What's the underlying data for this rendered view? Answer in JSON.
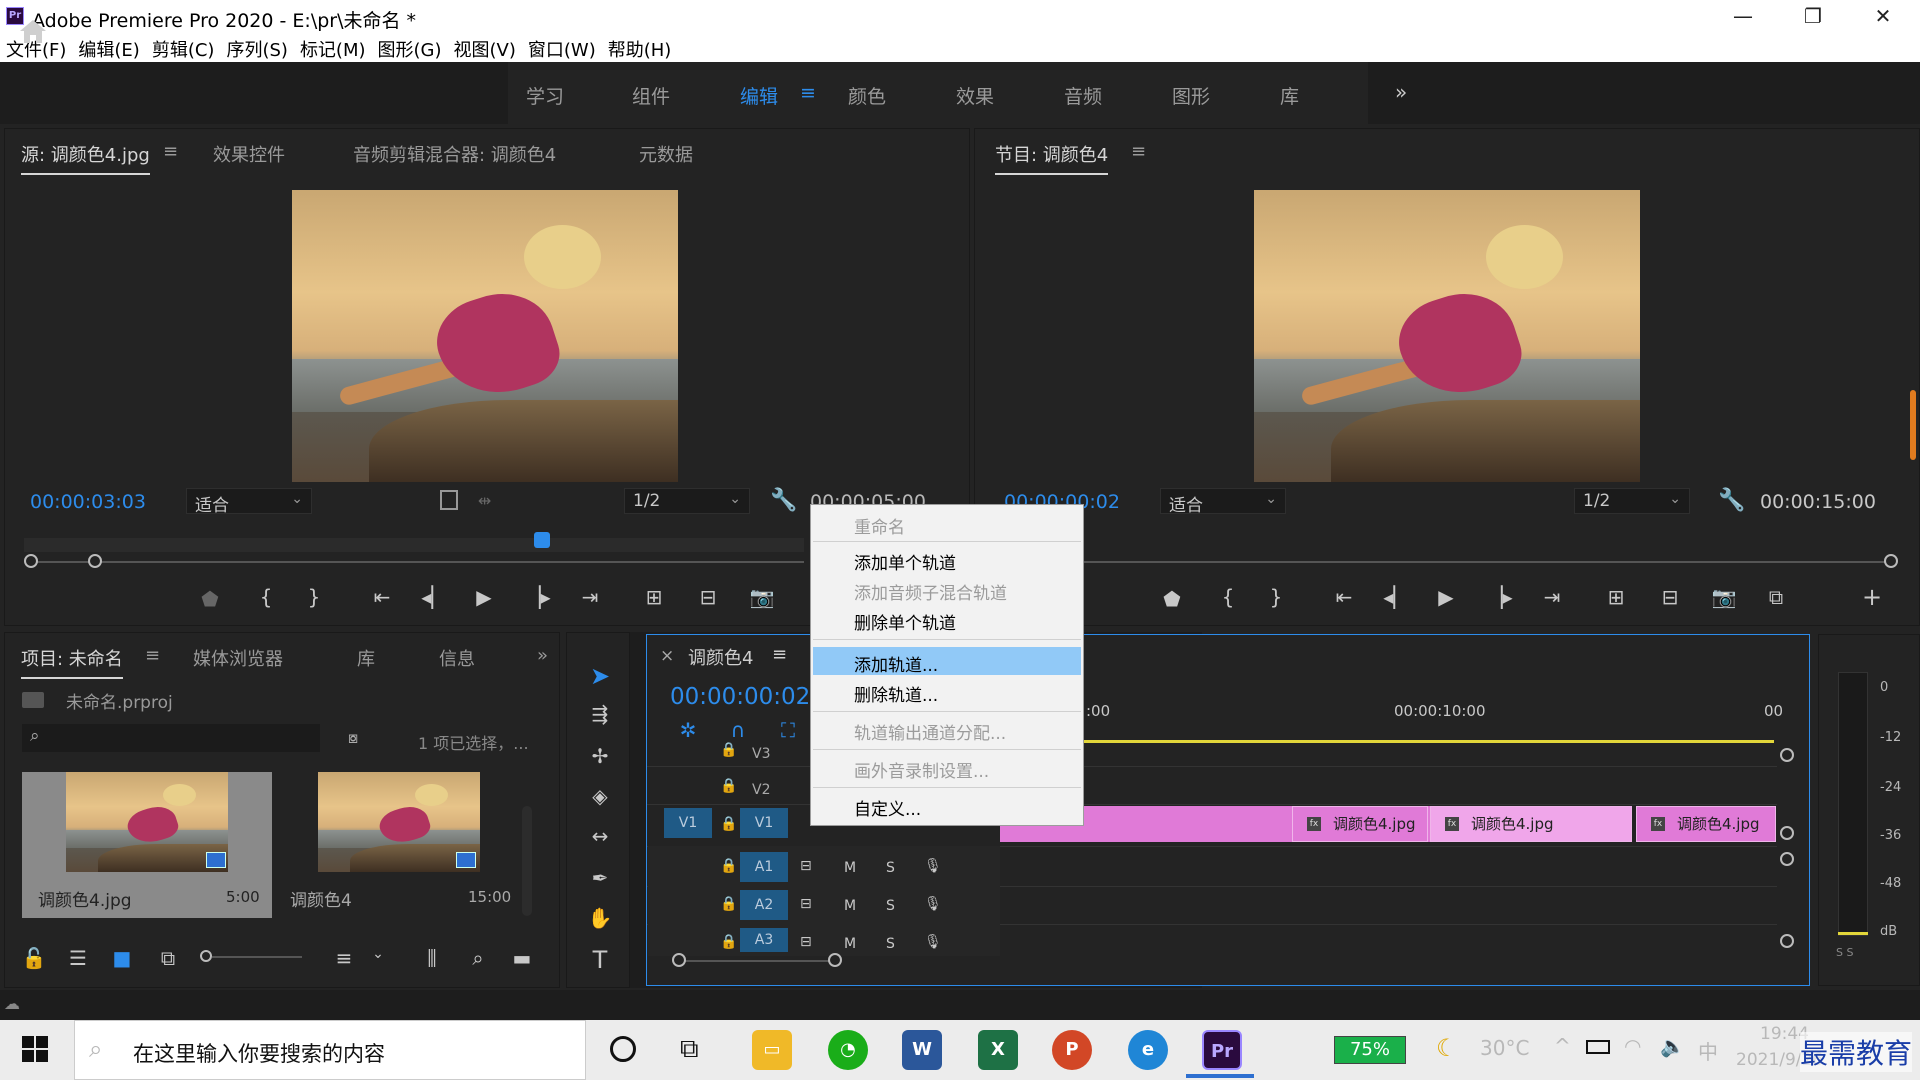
{
  "window": {
    "icon_text": "Pr",
    "title": "Adobe Premiere Pro 2020 - E:\\pr\\未命名 *",
    "minimize": "—",
    "restore": "❐",
    "close": "✕"
  },
  "menu": [
    "文件(F)",
    "编辑(E)",
    "剪辑(C)",
    "序列(S)",
    "标记(M)",
    "图形(G)",
    "视图(V)",
    "窗口(W)",
    "帮助(H)"
  ],
  "workspaces": {
    "tabs": [
      "学习",
      "组件",
      "编辑",
      "颜色",
      "效果",
      "音频",
      "图形",
      "库"
    ],
    "active": "编辑",
    "menu_glyph": "≡",
    "more": "»"
  },
  "source_panel": {
    "tabs": [
      "源: 调颜色4.jpg",
      "效果控件",
      "音频剪辑混合器: 调颜色4",
      "元数据"
    ],
    "menu_glyph": "≡",
    "timecode": "00:00:03:03",
    "zoom": "适合",
    "resolution": "1/2",
    "duration": "00:00:05:00"
  },
  "program_panel": {
    "tab": "节目: 调颜色4",
    "menu_glyph": "≡",
    "timecode": "00:00:00:02",
    "zoom": "适合",
    "resolution": "1/2",
    "duration": "00:00:15:00",
    "add": "+"
  },
  "project_panel": {
    "tabs": [
      "项目: 未命名",
      "媒体浏览器",
      "库",
      "信息"
    ],
    "menu_glyph": "≡",
    "more": "»",
    "file": "未命名.prproj",
    "selection": "1 项已选择，...",
    "items": [
      {
        "name": "调颜色4.jpg",
        "duration": "5:00"
      },
      {
        "name": "调颜色4",
        "duration": "15:00"
      }
    ]
  },
  "timeline": {
    "close": "×",
    "tab": "调颜色4",
    "menu_glyph": "≡",
    "timecode": "00:00:00:02",
    "ruler": [
      ":00",
      "00:00:10:00",
      "00"
    ],
    "tracks_video": [
      "V3",
      "V2",
      "V1"
    ],
    "tracks_audio": [
      "A1",
      "A2",
      "A3"
    ],
    "source_patch": "V1",
    "mute": "M",
    "solo": "S",
    "clips": [
      "调颜色4.jpg",
      "调颜色4.jpg",
      "调颜色4.jpg"
    ],
    "fx": "fx"
  },
  "context_menu": {
    "items": [
      {
        "label": "重命名",
        "disabled": true
      },
      {
        "label": "添加单个轨道",
        "disabled": false
      },
      {
        "label": "添加音频子混合轨道",
        "disabled": true
      },
      {
        "label": "删除单个轨道",
        "disabled": false
      },
      {
        "label": "添加轨道...",
        "disabled": false,
        "highlighted": true
      },
      {
        "label": "删除轨道...",
        "disabled": false
      },
      {
        "label": "轨道输出通道分配...",
        "disabled": true
      },
      {
        "label": "画外音录制设置...",
        "disabled": true
      },
      {
        "label": "自定义...",
        "disabled": false
      }
    ]
  },
  "meter": {
    "scale": [
      "0",
      "-12",
      "-24",
      "-36",
      "-48",
      "dB"
    ],
    "solo_buttons": "S S"
  },
  "taskbar": {
    "search_placeholder": "在这里输入你要搜索的内容",
    "battery": "75%",
    "weather": "30°C",
    "ime": "中",
    "time": "19:44",
    "date": "2021/9/26",
    "watermark": "最需教育"
  },
  "colors": {
    "accent": "#2d8ceb",
    "clip": "#e07ad7",
    "menu_highlight": "#91c9f7",
    "panel_bg": "#232323"
  }
}
